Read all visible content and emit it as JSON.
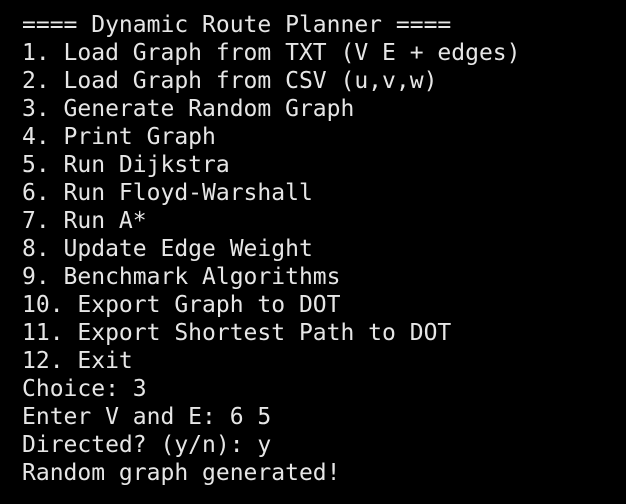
{
  "terminal": {
    "foreground": "#e6e6e6",
    "background": "#000000",
    "lines": [
      "==== Dynamic Route Planner ====",
      "1. Load Graph from TXT (V E + edges)",
      "2. Load Graph from CSV (u,v,w)",
      "3. Generate Random Graph",
      "4. Print Graph",
      "5. Run Dijkstra",
      "6. Run Floyd-Warshall",
      "7. Run A*",
      "8. Update Edge Weight",
      "9. Benchmark Algorithms",
      "10. Export Graph to DOT",
      "11. Export Shortest Path to DOT",
      "12. Exit",
      "Choice: 3",
      "Enter V and E: 6 5",
      "Directed? (y/n): y",
      "Random graph generated!"
    ]
  }
}
